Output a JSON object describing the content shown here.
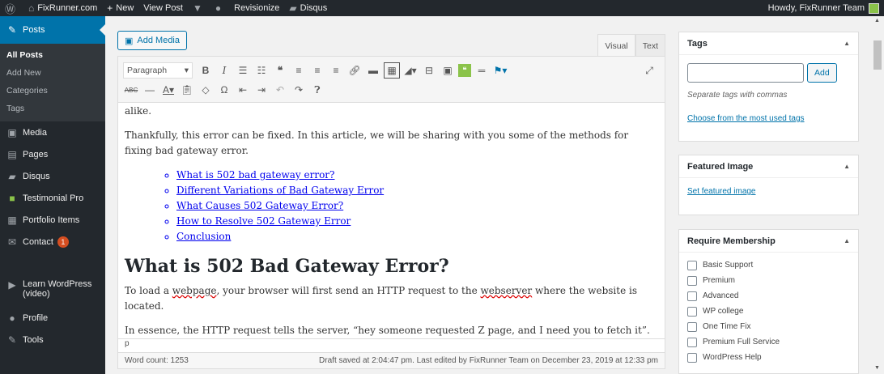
{
  "adminbar": {
    "site": "FixRunner.com",
    "new": "New",
    "view": "View Post",
    "revisionize": "Revisionize",
    "disqus": "Disqus",
    "howdy": "Howdy, FixRunner Team"
  },
  "sidebar": {
    "posts": "Posts",
    "sub": [
      "All Posts",
      "Add New",
      "Categories",
      "Tags"
    ],
    "items": [
      {
        "icon": "media-icon",
        "label": "Media"
      },
      {
        "icon": "pages-icon",
        "label": "Pages"
      },
      {
        "icon": "disqus-icon",
        "label": "Disqus"
      },
      {
        "icon": "testimonial-icon",
        "label": "Testimonial Pro"
      },
      {
        "icon": "portfolio-icon",
        "label": "Portfolio Items"
      }
    ],
    "contact": "Contact",
    "contact_badge": "1",
    "learn": "Learn WordPress",
    "learn2": "(video)",
    "profile": "Profile",
    "tools": "Tools"
  },
  "editor": {
    "add_media": "Add Media",
    "tab_visual": "Visual",
    "tab_text": "Text",
    "format": "Paragraph",
    "p_alike": "alike.",
    "p_thank": "Thankfully, this error can be fixed. In this article, we will be sharing with you some of the methods for fixing bad gateway error.",
    "toc": [
      "What is 502 bad gateway error?",
      "Different Variations of Bad Gateway Error",
      "What Causes 502 Gateway Error?",
      "How to Resolve 502 Gateway Error",
      "Conclusion"
    ],
    "h2": "What is 502 Bad Gateway Error?",
    "p_load_a": "To load a ",
    "p_load_b": "webpage",
    "p_load_c": ", your browser will first send an HTTP request to the ",
    "p_load_d": "webserver",
    "p_load_e": " where the website is located.",
    "p_essence": "In essence, the HTTP request tells the server, “hey someone requested Z page, and I need you to fetch it”.",
    "path": "p",
    "word_count": "Word count: 1253",
    "draft": "Draft saved at 2:04:47 pm. Last edited by FixRunner Team on December 23, 2019 at 12:33 pm"
  },
  "tags": {
    "title": "Tags",
    "add": "Add",
    "hint": "Separate tags with commas",
    "choose": "Choose from the most used tags"
  },
  "featured": {
    "title": "Featured Image",
    "set": "Set featured image"
  },
  "membership": {
    "title": "Require Membership",
    "options": [
      "Basic Support",
      "Premium",
      "Advanced",
      "WP college",
      "One Time Fix",
      "Premium Full Service",
      "WordPress Help"
    ]
  }
}
